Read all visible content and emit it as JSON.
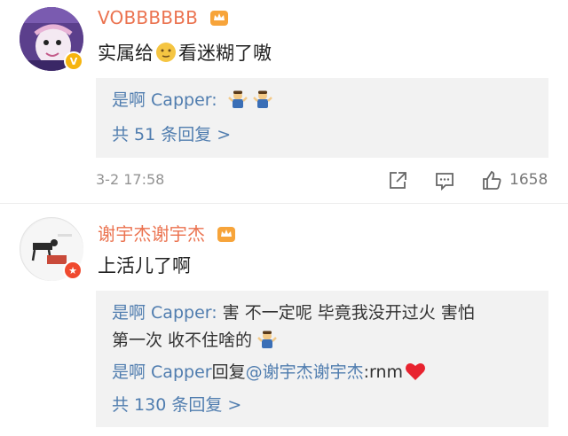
{
  "comments": [
    {
      "username": "VOBBBBBB",
      "text_before": "实属给",
      "text_after": "看迷糊了嗷",
      "replies": [
        {
          "user": "是啊 Capper:",
          "content": ""
        }
      ],
      "more_replies": "共 51 条回复 >",
      "timestamp": "3-2 17:58",
      "likes": "1658"
    },
    {
      "username": "谢宇杰谢宇杰",
      "text": "上活儿了啊",
      "replies": [
        {
          "user": "是啊 Capper:",
          "content": " 害 不一定呢 毕竟我没开过火 害怕",
          "content_line2": "第一次 收不住啥的"
        },
        {
          "user": "是啊 Capper",
          "middle": "回复",
          "mention": "@谢宇杰谢宇杰",
          "content": ":rnm"
        }
      ],
      "more_replies": "共 130 条回复 >"
    }
  ],
  "colors": {
    "username": "#eb7350",
    "link": "#507daf",
    "reply_bg": "#f2f2f2",
    "meta": "#939393"
  },
  "icons": [
    "crown-badge-icon",
    "share-icon",
    "comment-icon",
    "like-icon",
    "shrug-emoji-icon",
    "heart-emoji-icon",
    "face-emoji-icon"
  ]
}
